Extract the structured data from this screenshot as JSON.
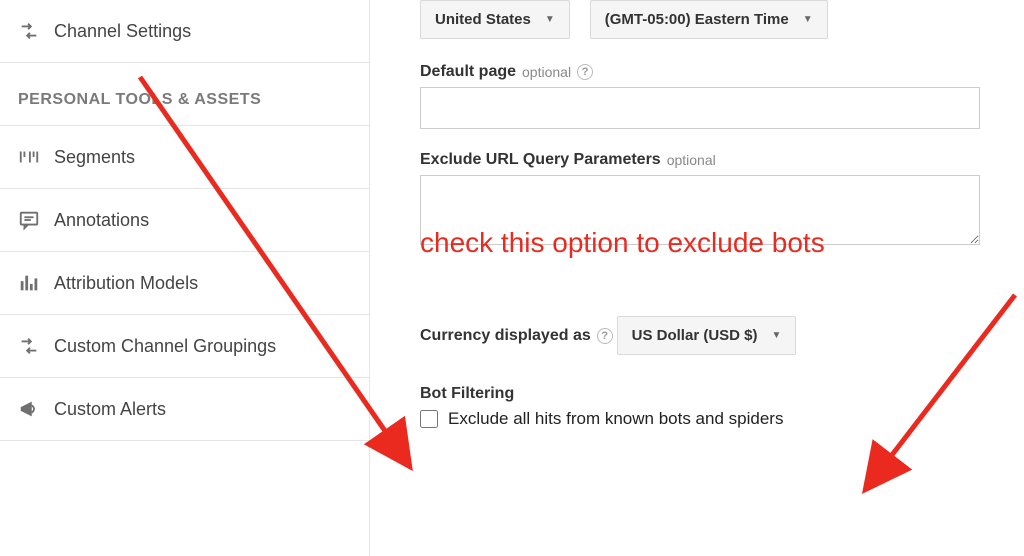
{
  "sidebar": {
    "items": [
      {
        "label": "Channel Settings"
      },
      {
        "label": "Segments"
      },
      {
        "label": "Annotations"
      },
      {
        "label": "Attribution Models"
      },
      {
        "label": "Custom Channel Groupings"
      },
      {
        "label": "Custom Alerts"
      }
    ],
    "section_header": "PERSONAL TOOLS & ASSETS"
  },
  "main": {
    "country_dropdown": "United States",
    "timezone_dropdown": "(GMT-05:00) Eastern Time",
    "default_page": {
      "label": "Default page",
      "optional": "optional",
      "value": ""
    },
    "exclude_params": {
      "label": "Exclude URL Query Parameters",
      "optional": "optional",
      "value": ""
    },
    "currency": {
      "label": "Currency displayed as",
      "dropdown": "US Dollar (USD $)"
    },
    "bot_filtering": {
      "label": "Bot Filtering",
      "checkbox_label": "Exclude all hits from known bots and spiders",
      "checked": false
    }
  },
  "annotation": {
    "text": "check this option to exclude bots"
  }
}
